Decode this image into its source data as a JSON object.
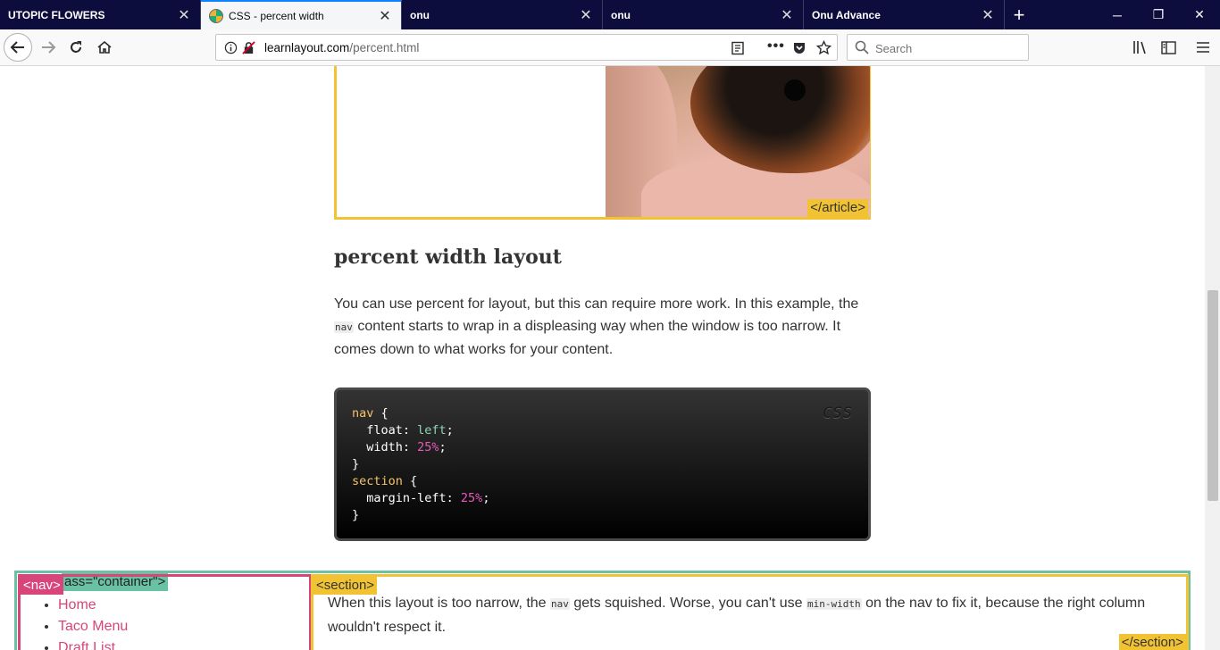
{
  "browser": {
    "tabs": [
      {
        "title": "UTOPIC FLOWERS",
        "active": false
      },
      {
        "title": "CSS - percent width",
        "active": true
      },
      {
        "title": "onu",
        "active": false
      },
      {
        "title": "onu",
        "active": false
      },
      {
        "title": "Onu Advance",
        "active": false
      }
    ],
    "url_host": "learnlayout.com",
    "url_path": "/percent.html",
    "search_placeholder": "Search"
  },
  "page": {
    "article_end_tag": "</article>",
    "heading": "percent width layout",
    "paragraph_part1": "You can use percent for layout, but this can require more work. In this example, the ",
    "paragraph_code": "nav",
    "paragraph_part2": " content starts to wrap in a displeasing way when the window is too narrow. It comes down to what works for your content.",
    "code_lang": "CSS",
    "code": {
      "l1_sel": "nav",
      "l1_brace": " {",
      "l2_prop": "  float: ",
      "l2_val": "left",
      "l2_end": ";",
      "l3_prop": "  width: ",
      "l3_val": "25%",
      "l3_end": ";",
      "l4": "}",
      "l5_sel": "section",
      "l5_brace": " {",
      "l6_prop": "  margin-left: ",
      "l6_val": "25%",
      "l6_end": ";",
      "l7": "}"
    },
    "demo": {
      "container_tag": "<div class=\"container\">",
      "container_tag_visible": "ass=\"container\">",
      "nav_tag": "<nav>",
      "nav_items": [
        "Home",
        "Taco Menu",
        "Draft List"
      ],
      "section_tag": "<section>",
      "section_end_tag": "</section>",
      "section_text_1": "When this layout is too narrow, the ",
      "section_code_1": "nav",
      "section_text_2": " gets squished. Worse, you can't use ",
      "section_code_2": "min-width",
      "section_text_3": " on the nav to fix it, because the right column wouldn't respect it."
    }
  }
}
